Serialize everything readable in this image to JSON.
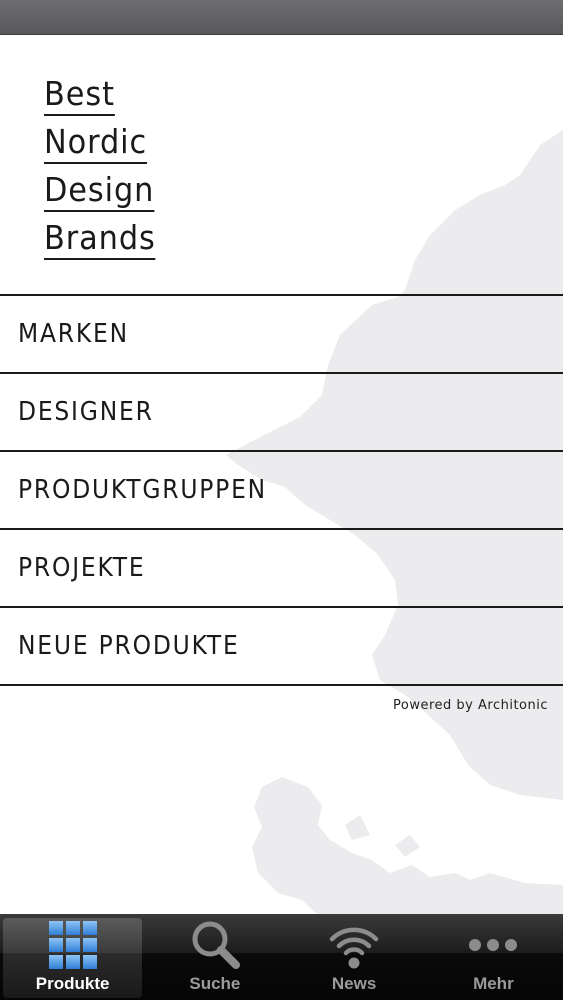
{
  "logo": {
    "lines": [
      "Best",
      "Nordic",
      "Design",
      "Brands"
    ]
  },
  "menu": {
    "items": [
      {
        "label": "MARKEN"
      },
      {
        "label": "DESIGNER"
      },
      {
        "label": "PRODUKTGRUPPEN"
      },
      {
        "label": "PROJEKTE"
      },
      {
        "label": "NEUE PRODUKTE"
      }
    ]
  },
  "footer": {
    "powered_by": "Powered by Architonic"
  },
  "tab_bar": {
    "active_tab": "Produkte",
    "tabs": [
      {
        "label": "Produkte",
        "icon": "grid-icon"
      },
      {
        "label": "Suche",
        "icon": "magnifier-icon"
      },
      {
        "label": "News",
        "icon": "wifi-icon"
      },
      {
        "label": "Mehr",
        "icon": "more-dots-icon"
      }
    ]
  },
  "colors": {
    "text": "#1a1a1a",
    "map": "#ececee",
    "tab_bar": "#1c1c1c",
    "tab_active_label": "#ffffff",
    "tab_inactive_label": "#9b9b9b",
    "grid_icon_blue": "#3d8fe0"
  }
}
